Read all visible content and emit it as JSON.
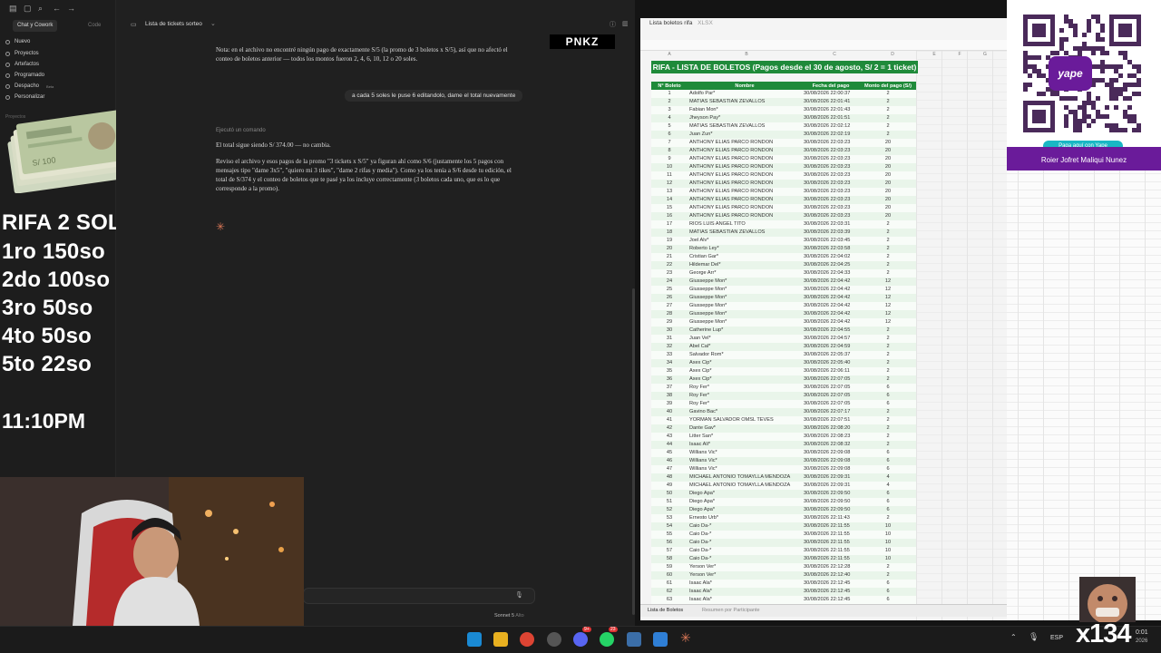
{
  "sidebar": {
    "tabs": [
      "Chat y Cowork",
      "Code"
    ],
    "items": [
      "Nuevo",
      "Proyectos",
      "Artefactos",
      "Programado",
      "Despacho",
      "Personalizar"
    ],
    "beta_label": "Beta",
    "section_label": "Proyectos"
  },
  "overlay": {
    "lines": [
      "RIFA 2 SOLES",
      "1ro 150so",
      "2do 100so",
      "3ro 50so",
      "4to 50so",
      "5to 22so"
    ],
    "clock": "11:10PM",
    "brand": "PNKZ",
    "counter": "x134"
  },
  "chat": {
    "title": "Lista de tickets sorteo",
    "note": "Nota: en el archivo no encontré ningún pago de exactamente S/5 (la promo de 3 boletos x S/5), así que no afectó el conteo de boletos anterior — todos los montos fueron 2, 4, 6, 10, 12 o 20 soles.",
    "user_message": "a cada 5 soles le puse 6 editandolo, dame el total nuevamente",
    "command_label": "Ejecutó un comando",
    "total_line": "El total sigue siendo S/ 374.00 — no cambia.",
    "explanation": "Reviso el archivo y esos pagos de la promo \"3 tickets x S/5\" ya figuran ahí como S/6 (justamente los 5 pagos con mensajes tipo \"dame 3x5\", \"quiero mi 3 tikes\", \"dame 2 rifas y media\"). Como ya los tenía a S/6 desde tu edición, el total de S/374 y el conteo de boletos que te pasé ya los incluye correctamente (3 boletos cada uno, que es lo que corresponde a la promo).",
    "model": "Sonnet 5",
    "effort": "Alto"
  },
  "sheet": {
    "file_title": "Lista boletos rifa",
    "file_ext": "XLSX",
    "banner": "RIFA - LISTA DE BOLETOS (Pagos desde el 30 de agosto, S/ 2 = 1 ticket)",
    "columns": [
      "N° Boleto",
      "Nombre",
      "Fecha del pago",
      "Monto del pago (S/)"
    ],
    "col_letters": [
      "A",
      "B",
      "C",
      "D",
      "E",
      "F",
      "G",
      "H"
    ],
    "tabs": [
      "Lista de Boletos",
      "Resumen por Participante"
    ],
    "rows": [
      [
        "1",
        "Adolfo Par*",
        "30/08/2026 22:00:37",
        "2"
      ],
      [
        "2",
        "MATIAS SEBASTIAN ZEVALLOS",
        "30/08/2026 22:01:41",
        "2"
      ],
      [
        "3",
        "Fabian Mon*",
        "30/08/2026 22:01:43",
        "2"
      ],
      [
        "4",
        "Jheyson Pay*",
        "30/08/2026 22:01:51",
        "2"
      ],
      [
        "5",
        "MATIAS SEBASTIAN ZEVALLOS",
        "30/08/2026 22:02:12",
        "2"
      ],
      [
        "6",
        "Juan Zun*",
        "30/08/2026 22:02:19",
        "2"
      ],
      [
        "7",
        "ANTHONY ELIAS PARCO RONDON",
        "30/08/2026 22:03:23",
        "20"
      ],
      [
        "8",
        "ANTHONY ELIAS PARCO RONDON",
        "30/08/2026 22:03:23",
        "20"
      ],
      [
        "9",
        "ANTHONY ELIAS PARCO RONDON",
        "30/08/2026 22:03:23",
        "20"
      ],
      [
        "10",
        "ANTHONY ELIAS PARCO RONDON",
        "30/08/2026 22:03:23",
        "20"
      ],
      [
        "11",
        "ANTHONY ELIAS PARCO RONDON",
        "30/08/2026 22:03:23",
        "20"
      ],
      [
        "12",
        "ANTHONY ELIAS PARCO RONDON",
        "30/08/2026 22:03:23",
        "20"
      ],
      [
        "13",
        "ANTHONY ELIAS PARCO RONDON",
        "30/08/2026 22:03:23",
        "20"
      ],
      [
        "14",
        "ANTHONY ELIAS PARCO RONDON",
        "30/08/2026 22:03:23",
        "20"
      ],
      [
        "15",
        "ANTHONY ELIAS PARCO RONDON",
        "30/08/2026 22:03:23",
        "20"
      ],
      [
        "16",
        "ANTHONY ELIAS PARCO RONDON",
        "30/08/2026 22:03:23",
        "20"
      ],
      [
        "17",
        "RIOS LUIS ANGEL TITO",
        "30/08/2026 22:03:31",
        "2"
      ],
      [
        "18",
        "MATIAS SEBASTIAN ZEVALLOS",
        "30/08/2026 22:03:39",
        "2"
      ],
      [
        "19",
        "Joel Alv*",
        "30/08/2026 22:03:45",
        "2"
      ],
      [
        "20",
        "Roberto Ley*",
        "30/08/2026 22:03:58",
        "2"
      ],
      [
        "21",
        "Cristian Gar*",
        "30/08/2026 22:04:02",
        "2"
      ],
      [
        "22",
        "Hildemar Del*",
        "30/08/2026 22:04:25",
        "2"
      ],
      [
        "23",
        "George Arr*",
        "30/08/2026 22:04:33",
        "2"
      ],
      [
        "24",
        "Giusseppe Mon*",
        "30/08/2026 22:04:42",
        "12"
      ],
      [
        "25",
        "Giusseppe Mon*",
        "30/08/2026 22:04:42",
        "12"
      ],
      [
        "26",
        "Giusseppe Mon*",
        "30/08/2026 22:04:42",
        "12"
      ],
      [
        "27",
        "Giusseppe Mon*",
        "30/08/2026 22:04:42",
        "12"
      ],
      [
        "28",
        "Giusseppe Mon*",
        "30/08/2026 22:04:42",
        "12"
      ],
      [
        "29",
        "Giusseppe Mon*",
        "30/08/2026 22:04:42",
        "12"
      ],
      [
        "30",
        "Catherine Lup*",
        "30/08/2026 22:04:55",
        "2"
      ],
      [
        "31",
        "Juan Vel*",
        "30/08/2026 22:04:57",
        "2"
      ],
      [
        "32",
        "Abel Cal*",
        "30/08/2026 22:04:59",
        "2"
      ],
      [
        "33",
        "Salvador Rom*",
        "30/08/2026 22:05:37",
        "2"
      ],
      [
        "34",
        "Axex Cip*",
        "30/08/2026 22:05:40",
        "2"
      ],
      [
        "35",
        "Axex Cip*",
        "30/08/2026 22:06:11",
        "2"
      ],
      [
        "36",
        "Axex Cip*",
        "30/08/2026 22:07:05",
        "2"
      ],
      [
        "37",
        "Roy Fer*",
        "30/08/2026 22:07:05",
        "6"
      ],
      [
        "38",
        "Roy Fer*",
        "30/08/2026 22:07:05",
        "6"
      ],
      [
        "39",
        "Roy Fer*",
        "30/08/2026 22:07:05",
        "6"
      ],
      [
        "40",
        "Gavino Bac*",
        "30/08/2026 22:07:17",
        "2"
      ],
      [
        "41",
        "YORMAN SALVADOR OMSL TEVES",
        "30/08/2026 22:07:51",
        "2"
      ],
      [
        "42",
        "Dante Gav*",
        "30/08/2026 22:08:20",
        "2"
      ],
      [
        "43",
        "Litter San*",
        "30/08/2026 22:08:23",
        "2"
      ],
      [
        "44",
        "Isaac Ali*",
        "30/08/2026 22:08:32",
        "2"
      ],
      [
        "45",
        "Willians Vic*",
        "30/08/2026 22:09:08",
        "6"
      ],
      [
        "46",
        "Willians Vic*",
        "30/08/2026 22:09:08",
        "6"
      ],
      [
        "47",
        "Willians Vic*",
        "30/08/2026 22:09:08",
        "6"
      ],
      [
        "48",
        "MICHAEL ANTONIO TOMAYLLA MENDOZA",
        "30/08/2026 22:09:31",
        "4"
      ],
      [
        "49",
        "MICHAEL ANTONIO TOMAYLLA MENDOZA",
        "30/08/2026 22:09:31",
        "4"
      ],
      [
        "50",
        "Diego Apa*",
        "30/08/2026 22:09:50",
        "6"
      ],
      [
        "51",
        "Diego Apa*",
        "30/08/2026 22:09:50",
        "6"
      ],
      [
        "52",
        "Diego Apa*",
        "30/08/2026 22:09:50",
        "6"
      ],
      [
        "53",
        "Ernesto Urb*",
        "30/08/2026 22:11:43",
        "2"
      ],
      [
        "54",
        "Caio Da-*",
        "30/08/2026 22:11:55",
        "10"
      ],
      [
        "55",
        "Caio Da-*",
        "30/08/2026 22:11:55",
        "10"
      ],
      [
        "56",
        "Caio Da-*",
        "30/08/2026 22:11:55",
        "10"
      ],
      [
        "57",
        "Caio Da-*",
        "30/08/2026 22:11:55",
        "10"
      ],
      [
        "58",
        "Caio Da-*",
        "30/08/2026 22:11:55",
        "10"
      ],
      [
        "59",
        "Yerson Ver*",
        "30/08/2026 22:12:28",
        "2"
      ],
      [
        "60",
        "Yerson Ver*",
        "30/08/2026 22:12:40",
        "2"
      ],
      [
        "61",
        "Isaac Ala*",
        "30/08/2026 22:12:45",
        "6"
      ],
      [
        "62",
        "Isaac Ala*",
        "30/08/2026 22:12:45",
        "6"
      ],
      [
        "63",
        "Isaac Ala*",
        "30/08/2026 22:12:45",
        "6"
      ]
    ]
  },
  "qr": {
    "cta": "Paga aquí con Yape",
    "owner": "Roier Jofret Maliqui Nunez",
    "logo_text": "yape"
  },
  "taskbar": {
    "lang": "ESP",
    "time": "0:01",
    "date": "2026",
    "badges": [
      "9+",
      "23"
    ]
  }
}
